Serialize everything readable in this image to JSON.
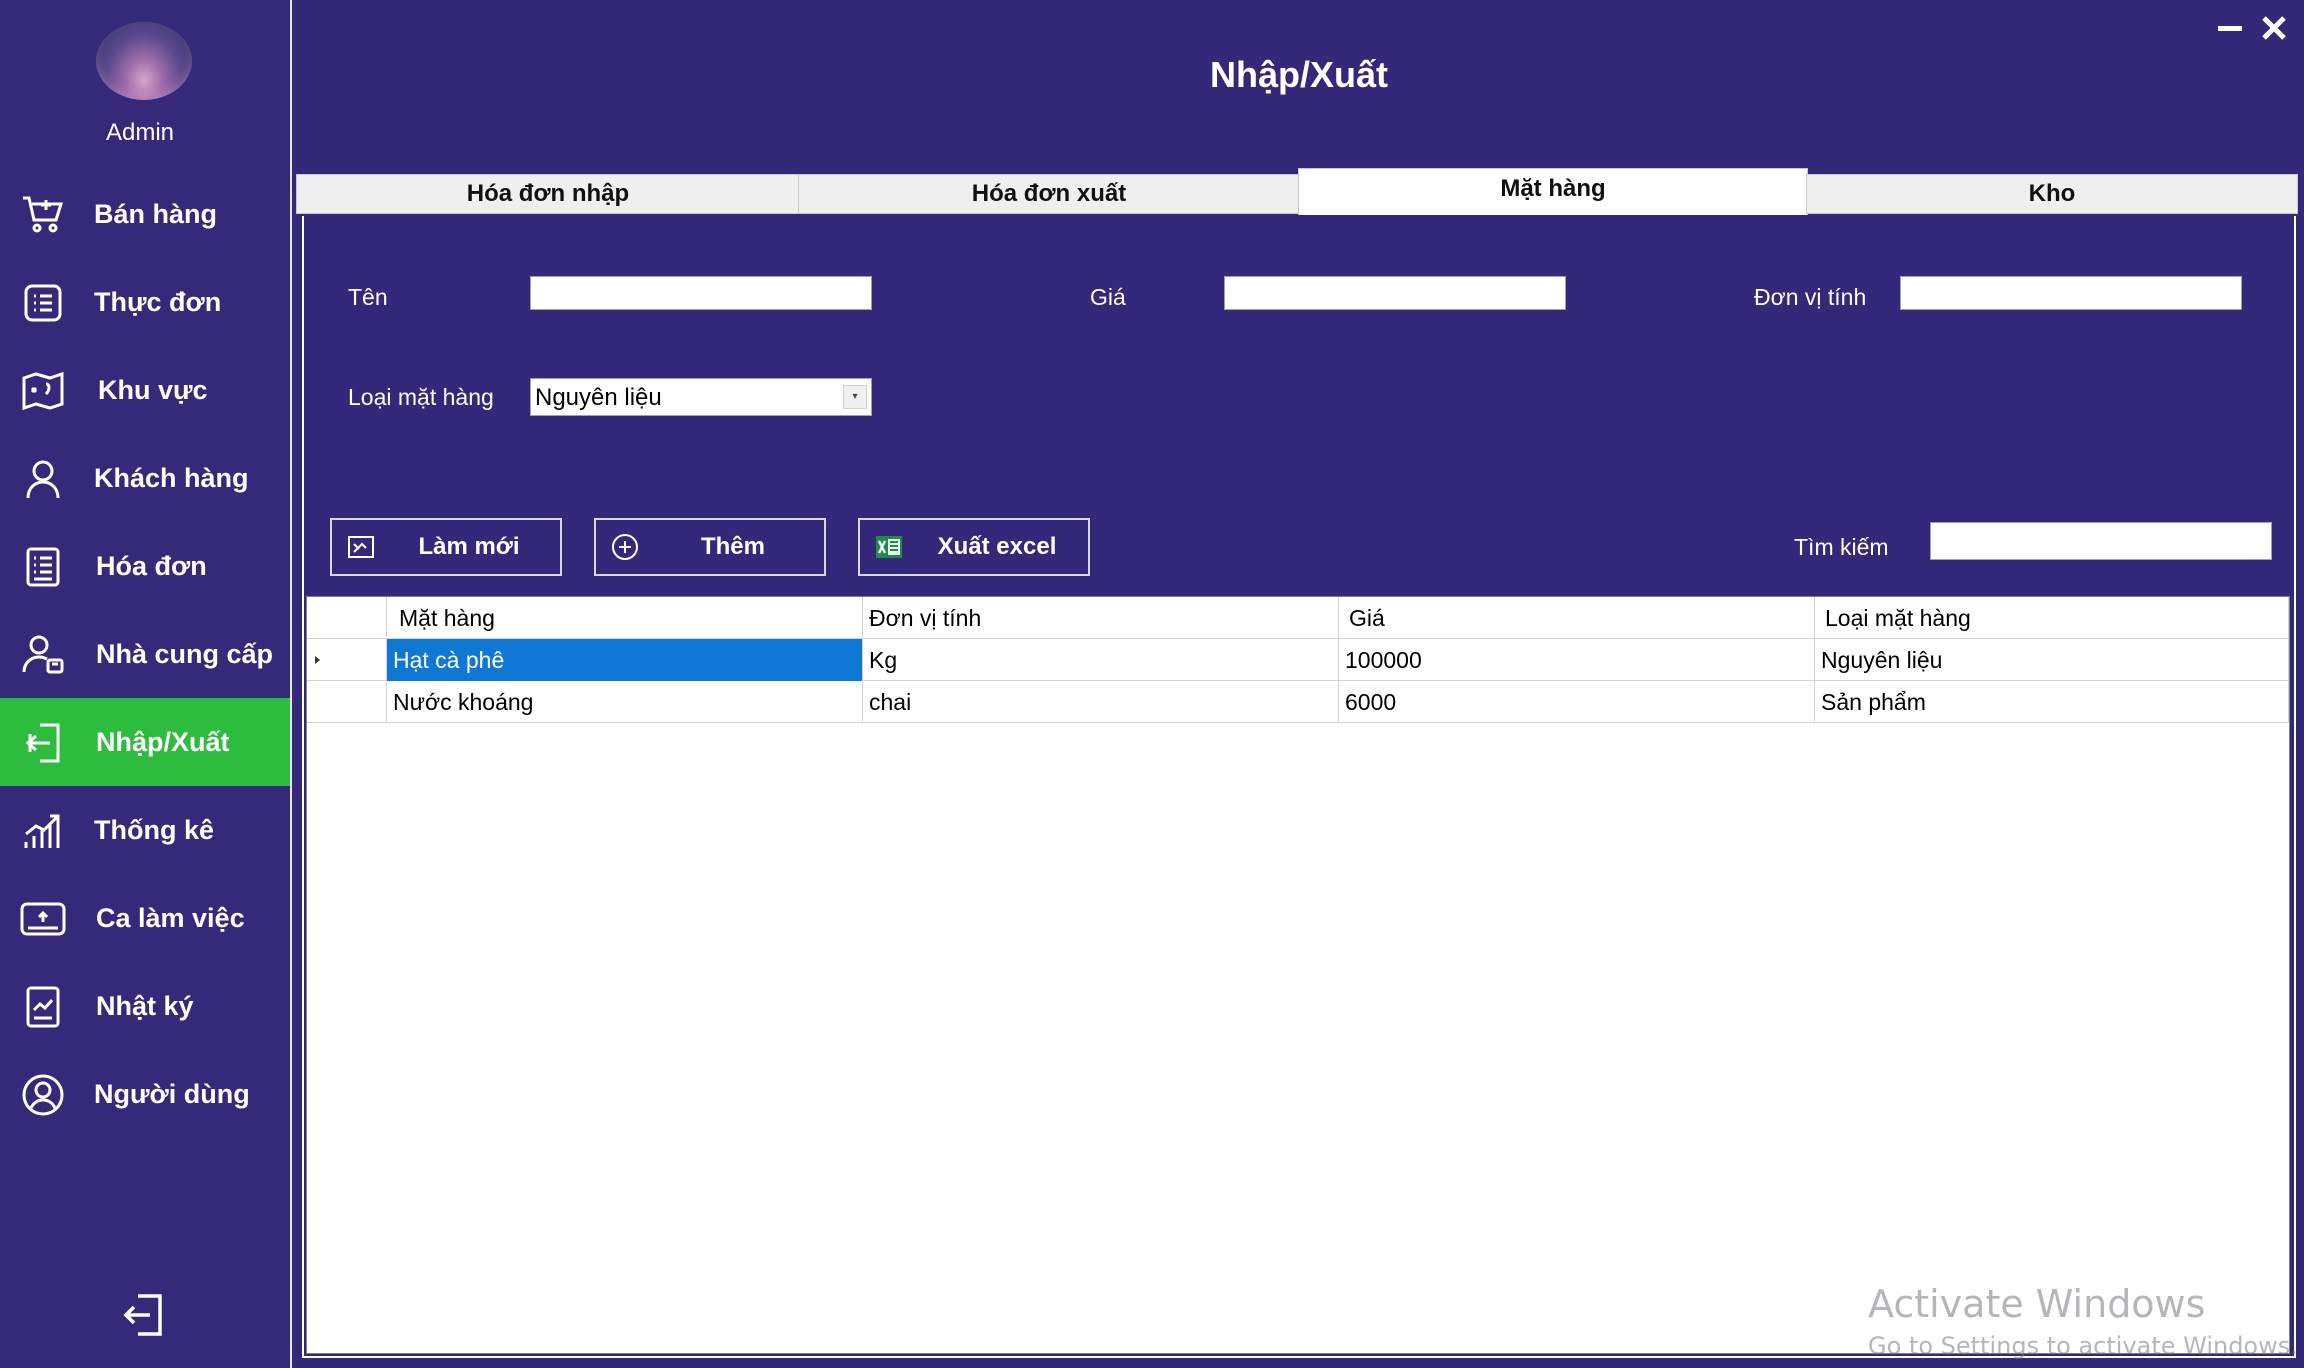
{
  "sidebar": {
    "user_label": "Admin",
    "items": [
      {
        "label": "Bán hàng",
        "icon": "cart-icon"
      },
      {
        "label": "Thực đơn",
        "icon": "menu-list-icon"
      },
      {
        "label": "Khu vực",
        "icon": "map-icon"
      },
      {
        "label": "Khách hàng",
        "icon": "customer-icon"
      },
      {
        "label": "Hóa đơn",
        "icon": "invoice-icon"
      },
      {
        "label": "Nhà cung cấp",
        "icon": "supplier-icon"
      },
      {
        "label": "Nhập/Xuất",
        "icon": "import-export-icon",
        "active": true
      },
      {
        "label": "Thống kê",
        "icon": "statistics-icon"
      },
      {
        "label": "Ca làm việc",
        "icon": "shift-icon"
      },
      {
        "label": "Nhật ký",
        "icon": "diary-icon"
      },
      {
        "label": "Người dùng",
        "icon": "user-icon"
      }
    ],
    "active_color": "#2ebc3e"
  },
  "header": {
    "title": "Nhập/Xuất"
  },
  "tabs": [
    {
      "label": "Hóa đơn nhập"
    },
    {
      "label": "Hóa đơn xuất"
    },
    {
      "label": "Mặt hàng",
      "active": true
    },
    {
      "label": "Kho"
    }
  ],
  "form": {
    "name_label": "Tên",
    "name_value": "",
    "price_label": "Giá",
    "price_value": "",
    "unit_label": "Đơn vị tính",
    "unit_value": "",
    "type_label": "Loại mặt hàng",
    "type_value": "Nguyên liệu"
  },
  "actions": {
    "refresh_label": "Làm mới",
    "add_label": "Thêm",
    "export_label": "Xuất excel",
    "search_label": "Tìm kiếm",
    "search_value": ""
  },
  "grid": {
    "columns": [
      "Mặt hàng",
      "Đơn vị tính",
      "Giá",
      "Loại mặt hàng"
    ],
    "rows": [
      [
        "Hạt cà phê",
        "Kg",
        "100000",
        "Nguyên liệu"
      ],
      [
        "Nước khoáng",
        "chai",
        "6000",
        "Sản phẩm"
      ]
    ]
  },
  "watermark": {
    "title": "Activate Windows",
    "subtitle": "Go to Settings to activate Windows."
  },
  "colors": {
    "background": "#352a7a",
    "selection": "#0f78d4"
  }
}
